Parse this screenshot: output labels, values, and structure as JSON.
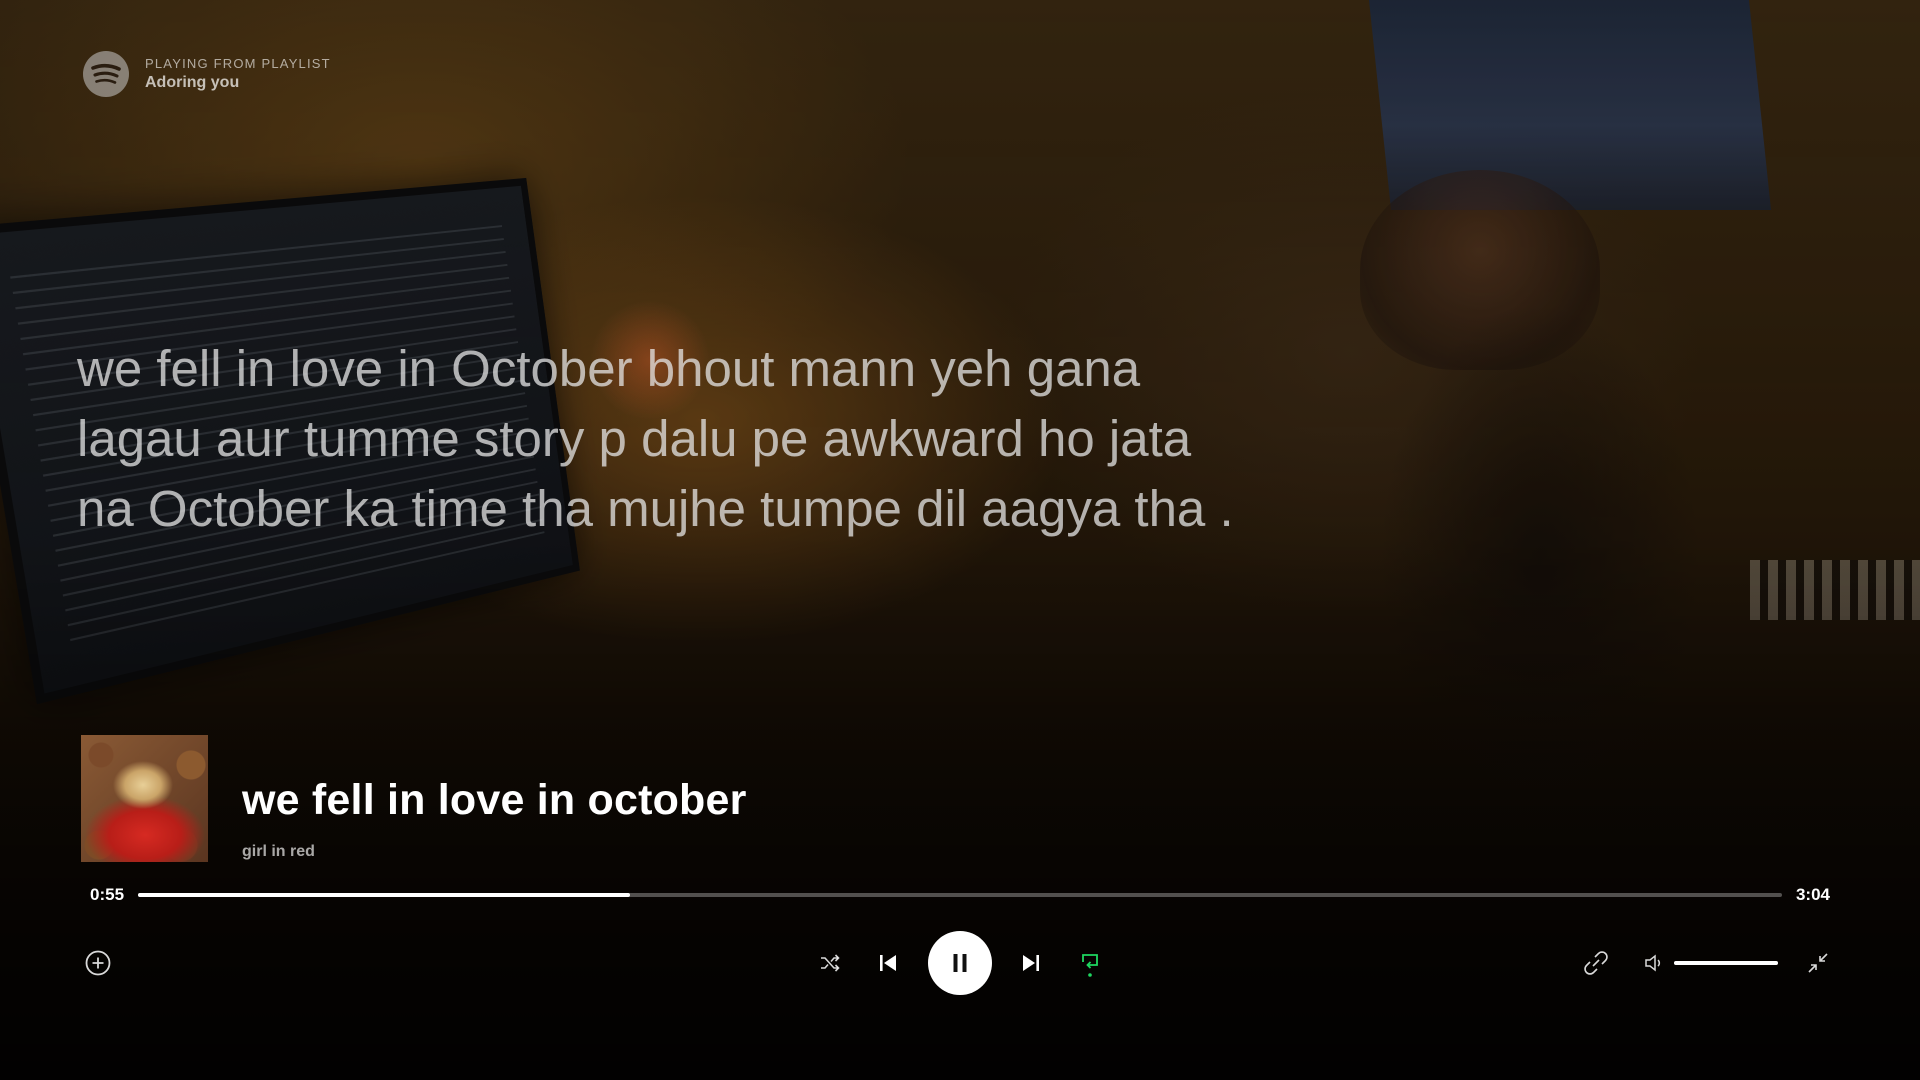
{
  "context": {
    "label": "PLAYING FROM PLAYLIST",
    "name": "Adoring you"
  },
  "lyrics": {
    "lines": [
      "we fell in love in October bhout mann yeh gana",
      "lagau aur tumme story p dalu pe awkward ho jata",
      "na October ka time tha mujhe tumpe dil aagya tha ."
    ]
  },
  "track": {
    "title": "we fell in love in october",
    "artist": "girl in red",
    "elapsed": "0:55",
    "duration": "3:04",
    "progress_fraction": 0.299
  },
  "player": {
    "shuffle_on": false,
    "repeat_on": true,
    "is_playing": true,
    "volume_fraction": 1.0
  },
  "icons": {
    "logo": "spotify-icon",
    "add": "plus-circle-icon",
    "shuffle": "shuffle-icon",
    "previous": "skip-previous-icon",
    "pause": "pause-icon",
    "next": "skip-next-icon",
    "repeat": "repeat-icon",
    "connect": "link-icon",
    "volume": "volume-icon",
    "minimize": "exit-fullscreen-icon"
  },
  "colors": {
    "accent": "#1ed760",
    "text": "#ffffff",
    "track_bg": "rgba(255,255,255,0.3)"
  }
}
